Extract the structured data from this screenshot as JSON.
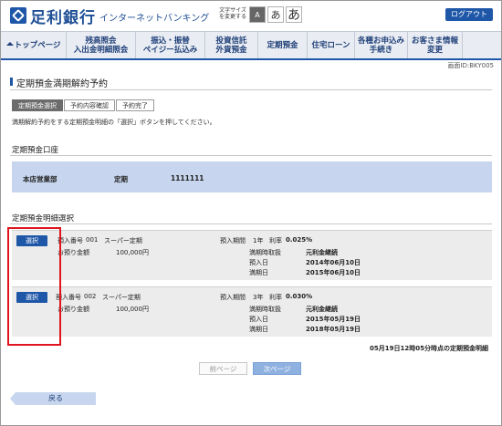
{
  "header": {
    "bank_name": "足利銀行",
    "bank_sub": "インターネットバンキング",
    "font_size_label": "文字サイズを変更する",
    "font_sizes": [
      "A",
      "あ",
      "あ"
    ],
    "logout": "ログアウト"
  },
  "nav": {
    "items": [
      {
        "label": "トップページ"
      },
      {
        "label": "残高照会\n入出金明細照会"
      },
      {
        "label": "振込・振替\nペイジー払込み"
      },
      {
        "label": "投資信託\n外貨預金"
      },
      {
        "label": "定期預金"
      },
      {
        "label": "住宅ローン"
      },
      {
        "label": "各種お申込み\n手続き"
      },
      {
        "label": "お客さま情報\n変更"
      }
    ]
  },
  "screen_id": "画面ID:BKY005",
  "page": {
    "title": "定期預金満期解約予約",
    "steps": [
      "定期預金選択",
      "予約内容確認",
      "予約完了"
    ],
    "instruction": "満期解約予約をする定期預金明細の「選択」ボタンを押してください。"
  },
  "account_section": {
    "title": "定期預金口座",
    "branch": "本店営業部",
    "type": "定期",
    "number": "1111111"
  },
  "deposits_section": {
    "title": "定期預金明細選択",
    "select_label": "選択",
    "rows": [
      {
        "deposit_no_label": "預入番号",
        "deposit_no": "001",
        "product": "スーパー定期",
        "amount_label": "お預り金額",
        "amount": "100,000円",
        "period_label": "預入期間",
        "period": "1年",
        "rate_label": "利率",
        "rate": "0.025%",
        "maturity_method_label": "満期時取扱",
        "maturity_method": "元利金継続",
        "deposit_date_label": "預入日",
        "deposit_date": "2014年06月10日",
        "maturity_date_label": "満期日",
        "maturity_date": "2015年06月10日"
      },
      {
        "deposit_no_label": "預入番号",
        "deposit_no": "002",
        "product": "スーパー定期",
        "amount_label": "お預り金額",
        "amount": "100,000円",
        "period_label": "預入期間",
        "period": "3年",
        "rate_label": "利率",
        "rate": "0.030%",
        "maturity_method_label": "満期時取扱",
        "maturity_method": "元利金継続",
        "deposit_date_label": "預入日",
        "deposit_date": "2015年05月19日",
        "maturity_date_label": "満期日",
        "maturity_date": "2018年05月19日"
      }
    ],
    "as_of": "05月19日12時05分時点の定期預金明細"
  },
  "pager": {
    "prev": "前ページ",
    "next": "次ページ"
  },
  "back_label": "戻る",
  "colors": {
    "brand_blue": "#1f57a8",
    "light_blue": "#c7d6ee",
    "highlight_red": "#e0141e"
  }
}
